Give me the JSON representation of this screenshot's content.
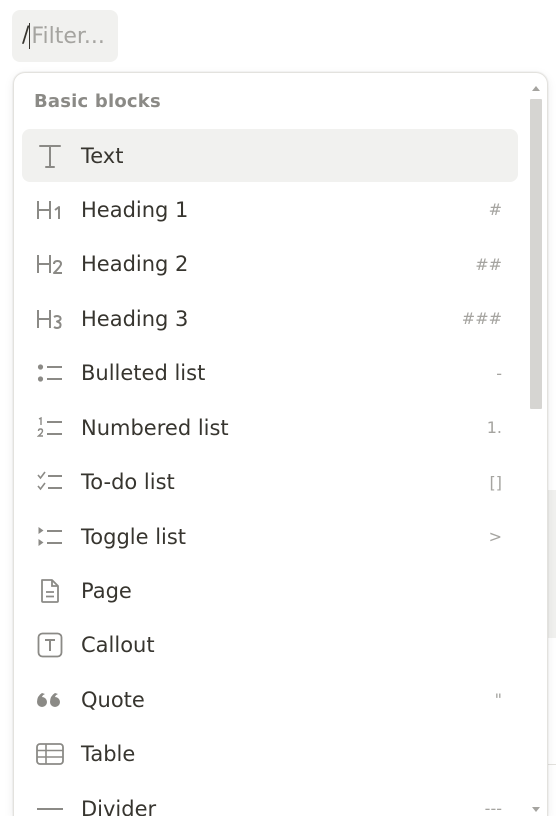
{
  "filter": {
    "prefix": "/",
    "placeholder": "Filter..."
  },
  "menu": {
    "section_title": "Basic blocks",
    "items": [
      {
        "label": "Text",
        "shortcut": "",
        "icon": "text-icon"
      },
      {
        "label": "Heading 1",
        "shortcut": "#",
        "icon": "heading-1-icon"
      },
      {
        "label": "Heading 2",
        "shortcut": "##",
        "icon": "heading-2-icon"
      },
      {
        "label": "Heading 3",
        "shortcut": "###",
        "icon": "heading-3-icon"
      },
      {
        "label": "Bulleted list",
        "shortcut": "-",
        "icon": "bulleted-list-icon"
      },
      {
        "label": "Numbered list",
        "shortcut": "1.",
        "icon": "numbered-list-icon"
      },
      {
        "label": "To-do list",
        "shortcut": "[]",
        "icon": "todo-list-icon"
      },
      {
        "label": "Toggle list",
        "shortcut": ">",
        "icon": "toggle-list-icon"
      },
      {
        "label": "Page",
        "shortcut": "",
        "icon": "page-icon"
      },
      {
        "label": "Callout",
        "shortcut": "",
        "icon": "callout-icon"
      },
      {
        "label": "Quote",
        "shortcut": "\"",
        "icon": "quote-icon"
      },
      {
        "label": "Table",
        "shortcut": "",
        "icon": "table-icon"
      },
      {
        "label": "Divider",
        "shortcut": "---",
        "icon": "divider-icon"
      }
    ]
  },
  "colors": {
    "text": "#37352f",
    "muted": "#a5a4a0",
    "hover_bg": "#f1f1ef",
    "scroll_thumb": "#d6d5d2"
  }
}
